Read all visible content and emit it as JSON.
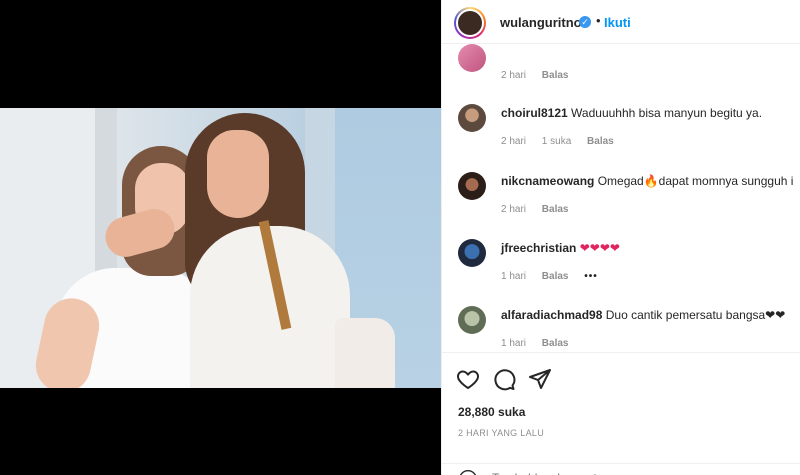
{
  "post": {
    "username": "wulanguritno",
    "follow_label": "Ikuti",
    "separator": "•"
  },
  "comments": [
    {
      "user": "",
      "text": "",
      "time": "2 hari",
      "likes": "",
      "reply": "Balas"
    },
    {
      "user": "choirul8121",
      "text": "Waduuuhhh bisa manyun begitu ya.",
      "time": "2 hari",
      "likes": "1 suka",
      "reply": "Balas"
    },
    {
      "user": "nikcnameowang",
      "text": "Omegad🔥dapat momnya sungguh i",
      "time": "2 hari",
      "likes": "",
      "reply": "Balas"
    },
    {
      "user": "jfreechristian",
      "text": "❤❤❤❤",
      "time": "1 hari",
      "likes": "",
      "reply": "Balas",
      "more": "•••"
    },
    {
      "user": "alfaradiachmad98",
      "text": "Duo cantik pemersatu bangsa❤❤",
      "time": "1 hari",
      "likes": "",
      "reply": "Balas"
    }
  ],
  "footer": {
    "likes": "28,880 suka",
    "time_ago": "2 HARI YANG LALU",
    "add_comment_placeholder": "Tambahkan komentar..."
  },
  "icons": [
    "heart-icon",
    "comment-icon",
    "share-icon",
    "verified-icon",
    "emoji-icon"
  ],
  "colors": {
    "link": "#0095f6",
    "muted": "#8e8e8e",
    "verified": "#3897f0"
  }
}
